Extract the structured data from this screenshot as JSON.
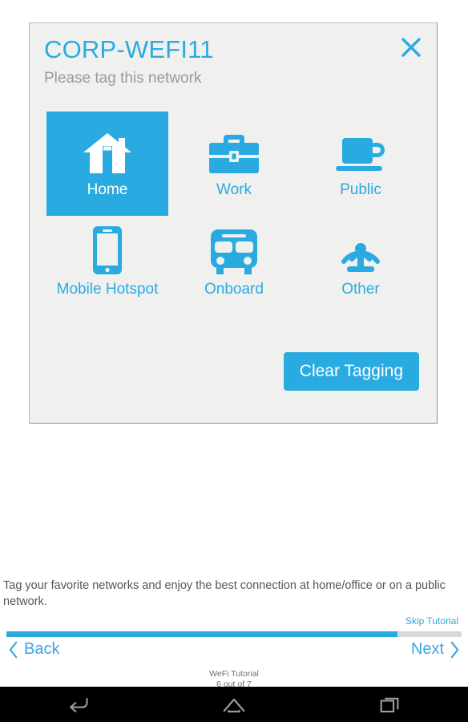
{
  "colors": {
    "accent": "#29abe2",
    "link": "#3aa6de",
    "card_bg": "#f0f0ef",
    "page_bg": "#ffffff",
    "muted_text": "#9b9b9b",
    "navbar_bg": "#000000"
  },
  "dialog": {
    "network_name": "CORP-WEFI11",
    "subtitle": "Please tag this network",
    "close_icon": "close-x-icon",
    "clear_button_label": "Clear Tagging",
    "tags": [
      {
        "label": "Home",
        "icon": "house-icon",
        "selected": true
      },
      {
        "label": "Work",
        "icon": "briefcase-icon",
        "selected": false
      },
      {
        "label": "Public",
        "icon": "coffee-cup-icon",
        "selected": false
      },
      {
        "label": "Mobile Hotspot",
        "icon": "smartphone-icon",
        "selected": false
      },
      {
        "label": "Onboard",
        "icon": "bus-icon",
        "selected": false
      },
      {
        "label": "Other",
        "icon": "broadcast-tower-icon",
        "selected": false
      }
    ]
  },
  "tutorial": {
    "description": "Tag your favorite networks and enjoy the best connection at home/office or on a public network.",
    "skip_label": "Skip Tutorial",
    "back_label": "Back",
    "next_label": "Next",
    "title": "WeFi Tutorial",
    "step_text": "6 out of 7",
    "current_step": 6,
    "total_steps": 7,
    "progress_percent": 86
  },
  "android_navbar": {
    "buttons": [
      {
        "name": "back-nav-icon",
        "icon": "back-arrow-icon"
      },
      {
        "name": "home-nav-icon",
        "icon": "home-outline-icon"
      },
      {
        "name": "recents-nav-icon",
        "icon": "recent-apps-icon"
      }
    ]
  }
}
